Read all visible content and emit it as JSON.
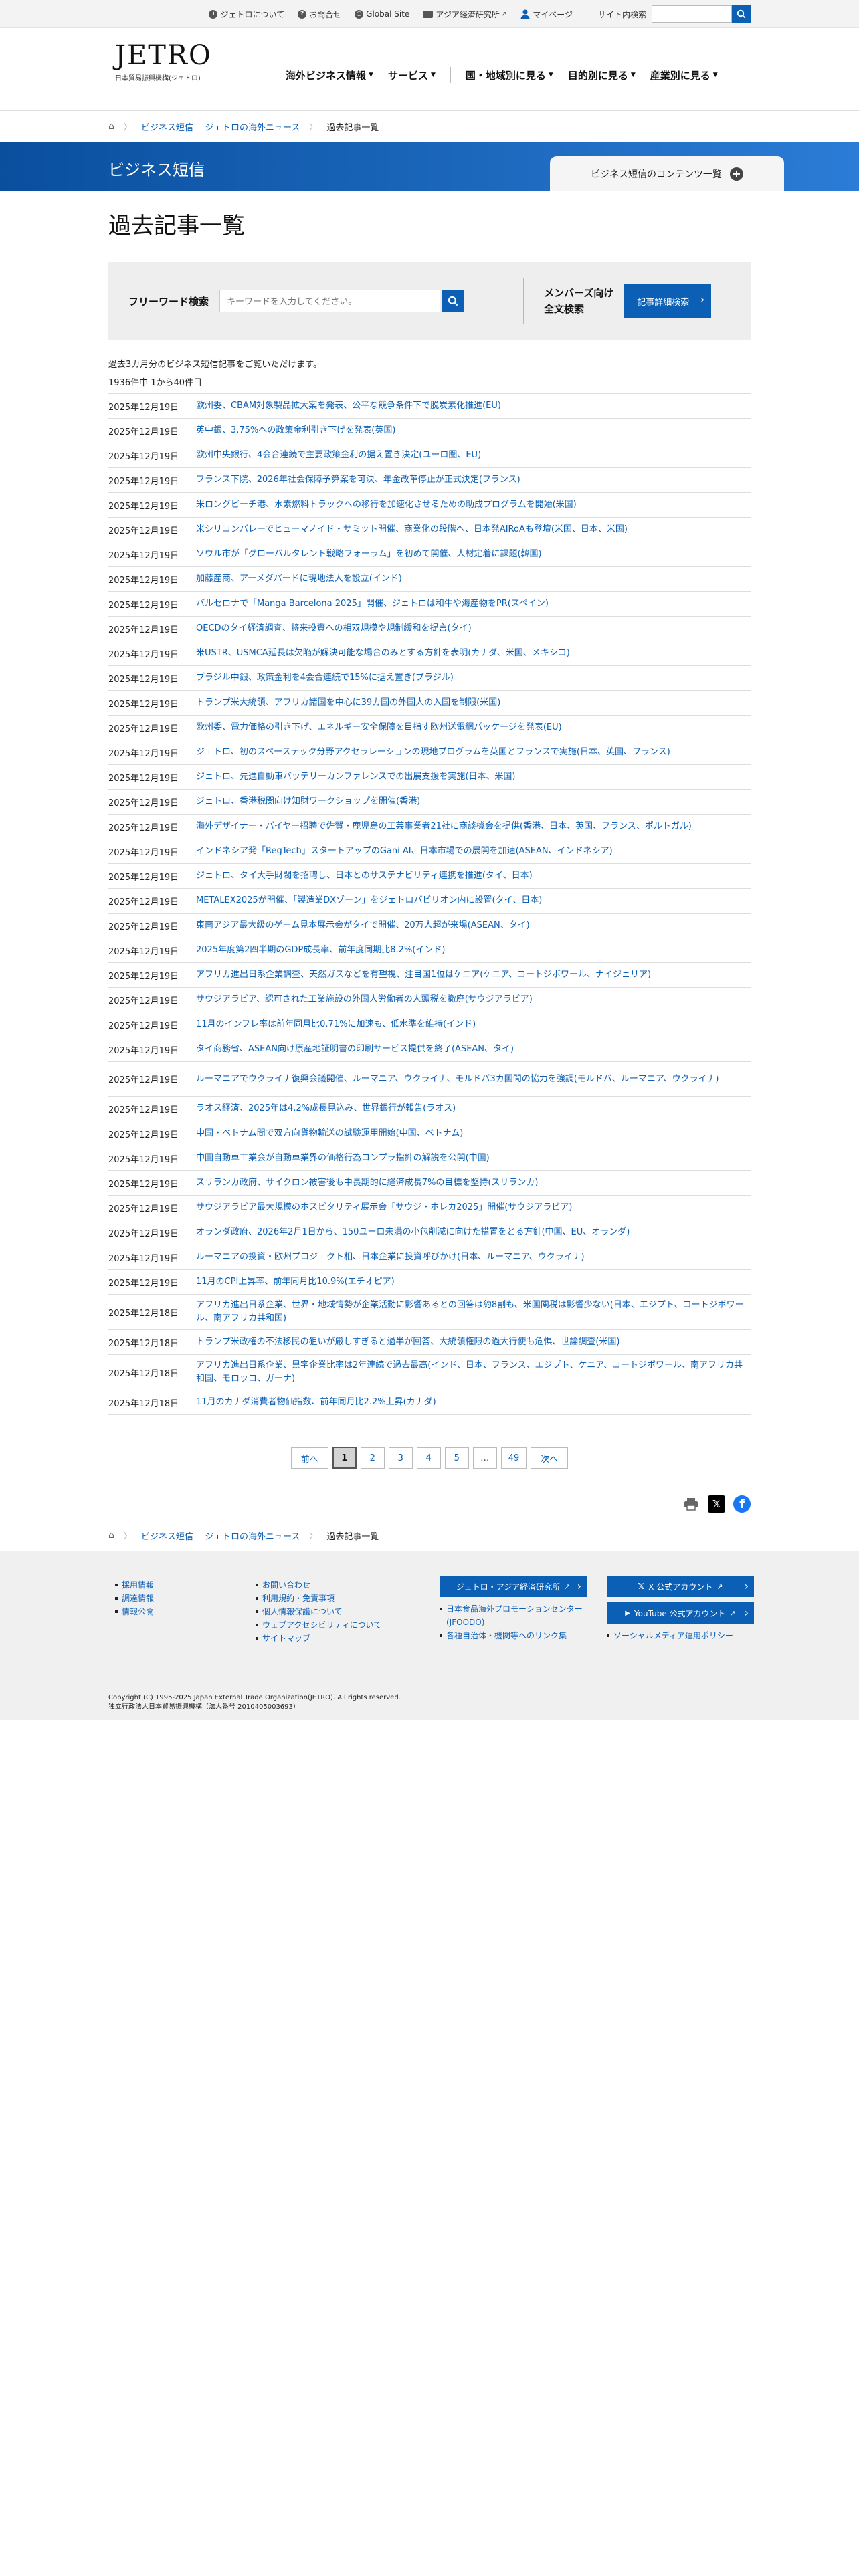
{
  "utility": {
    "about": "ジェトロについて",
    "contact": "お問合せ",
    "global": "Global Site",
    "ide": "アジア経済研究所",
    "mypage": "マイページ",
    "site_search_label": "サイト内検索"
  },
  "logo": {
    "main": "JETRO",
    "sub": "日本貿易振興機構(ジェトロ)"
  },
  "gnav": [
    {
      "label": "海外ビジネス情報"
    },
    {
      "label": "サービス"
    },
    {
      "label": "国・地域別に見る"
    },
    {
      "label": "目的別に見る"
    },
    {
      "label": "産業別に見る"
    }
  ],
  "breadcrumb": {
    "level1": "ビジネス短信 —ジェトロの海外ニュース",
    "current": "過去記事一覧"
  },
  "banner": {
    "title": "ビジネス短信",
    "contents_button": "ビジネス短信のコンテンツ一覧"
  },
  "page_title": "過去記事一覧",
  "search": {
    "freeword_label": "フリーワード検索",
    "placeholder": "キーワードを入力してください。",
    "members_label_1": "メンバーズ向け",
    "members_label_2": "全文検索",
    "detail_button": "記事詳細検索"
  },
  "intro": "過去3カ月分のビジネス短信記事をご覧いただけます。",
  "count": "1936件中 1から40件目",
  "news": [
    {
      "date": "2025年12月19日",
      "title": "欧州委、CBAM対象製品拡大案を発表、公平な競争条件下で脱炭素化推進(EU)"
    },
    {
      "date": "2025年12月19日",
      "title": "英中銀、3.75%への政策金利引き下げを発表(英国)"
    },
    {
      "date": "2025年12月19日",
      "title": "欧州中央銀行、4会合連続で主要政策金利の据え置き決定(ユーロ圏、EU)"
    },
    {
      "date": "2025年12月19日",
      "title": "フランス下院、2026年社会保障予算案を可決、年金改革停止が正式決定(フランス)"
    },
    {
      "date": "2025年12月19日",
      "title": "米ロングビーチ港、水素燃料トラックへの移行を加速化させるための助成プログラムを開始(米国)"
    },
    {
      "date": "2025年12月19日",
      "title": "米シリコンバレーでヒューマノイド・サミット開催、商業化の段階へ、日本発AIRoAも登壇(米国、日本、米国)"
    },
    {
      "date": "2025年12月19日",
      "title": "ソウル市が「グローバルタレント戦略フォーラム」を初めて開催、人材定着に課題(韓国)"
    },
    {
      "date": "2025年12月19日",
      "title": "加藤産商、アーメダバードに現地法人を設立(インド)"
    },
    {
      "date": "2025年12月19日",
      "title": "バルセロナで「Manga Barcelona 2025」開催、ジェトロは和牛や海産物をPR(スペイン)"
    },
    {
      "date": "2025年12月19日",
      "title": "OECDのタイ経済調査、将来投資への相双規模や規制緩和を提言(タイ)"
    },
    {
      "date": "2025年12月19日",
      "title": "米USTR、USMCA延長は欠陥が解決可能な場合のみとする方針を表明(カナダ、米国、メキシコ)"
    },
    {
      "date": "2025年12月19日",
      "title": "ブラジル中銀、政策金利を4会合連続で15%に据え置き(ブラジル)"
    },
    {
      "date": "2025年12月19日",
      "title": "トランプ米大統領、アフリカ諸国を中心に39カ国の外国人の入国を制限(米国)"
    },
    {
      "date": "2025年12月19日",
      "title": "欧州委、電力価格の引き下げ、エネルギー安全保障を目指す欧州送電網パッケージを発表(EU)"
    },
    {
      "date": "2025年12月19日",
      "title": "ジェトロ、初のスペーステック分野アクセラレーションの現地プログラムを英国とフランスで実施(日本、英国、フランス)"
    },
    {
      "date": "2025年12月19日",
      "title": "ジェトロ、先進自動車バッテリーカンファレンスでの出展支援を実施(日本、米国)"
    },
    {
      "date": "2025年12月19日",
      "title": "ジェトロ、香港税関向け知財ワークショップを開催(香港)"
    },
    {
      "date": "2025年12月19日",
      "title": "海外デザイナー・バイヤー招聘で佐賀・鹿児島の工芸事業者21社に商談機会を提供(香港、日本、英国、フランス、ポルトガル)"
    },
    {
      "date": "2025年12月19日",
      "title": "インドネシア発「RegTech」スタートアップのGani AI、日本市場での展開を加速(ASEAN、インドネシア)"
    },
    {
      "date": "2025年12月19日",
      "title": "ジェトロ、タイ大手財閥を招聘し、日本とのサステナビリティ連携を推進(タイ、日本)"
    },
    {
      "date": "2025年12月19日",
      "title": "METALEX2025が開催、「製造業DXゾーン」をジェトロパビリオン内に設置(タイ、日本)"
    },
    {
      "date": "2025年12月19日",
      "title": "東南アジア最大級のゲーム見本展示会がタイで開催、20万人超が来場(ASEAN、タイ)"
    },
    {
      "date": "2025年12月19日",
      "title": "2025年度第2四半期のGDP成長率、前年度同期比8.2%(インド)"
    },
    {
      "date": "2025年12月19日",
      "title": "アフリカ進出日系企業調査、天然ガスなどを有望視、注目国1位はケニア(ケニア、コートジボワール、ナイジェリア)"
    },
    {
      "date": "2025年12月19日",
      "title": "サウジアラビア、認可された工業施設の外国人労働者の人頭税を撤廃(サウジアラビア)"
    },
    {
      "date": "2025年12月19日",
      "title": "11月のインフレ率は前年同月比0.71%に加速も、低水準を維持(インド)"
    },
    {
      "date": "2025年12月19日",
      "title": "タイ商務省、ASEAN向け原産地証明書の印刷サービス提供を終了(ASEAN、タイ)"
    },
    {
      "date": "2025年12月19日",
      "title": "ルーマニアでウクライナ復興会議開催、ルーマニア、ウクライナ、モルドバ3カ国間の協力を強調(モルドバ、ルーマニア、ウクライナ)"
    },
    {
      "date": "2025年12月19日",
      "title": "ラオス経済、2025年は4.2%成長見込み、世界銀行が報告(ラオス)"
    },
    {
      "date": "2025年12月19日",
      "title": "中国・ベトナム間で双方向貨物輸送の試験運用開始(中国、ベトナム)"
    },
    {
      "date": "2025年12月19日",
      "title": "中国自動車工業会が自動車業界の価格行為コンプラ指針の解説を公開(中国)"
    },
    {
      "date": "2025年12月19日",
      "title": "スリランカ政府、サイクロン被害後も中長期的に経済成長7%の目標を堅持(スリランカ)"
    },
    {
      "date": "2025年12月19日",
      "title": "サウジアラビア最大規模のホスピタリティ展示会「サウジ・ホレカ2025」開催(サウジアラビア)"
    },
    {
      "date": "2025年12月19日",
      "title": "オランダ政府、2026年2月1日から、150ユーロ未満の小包削減に向けた措置をとる方針(中国、EU、オランダ)"
    },
    {
      "date": "2025年12月19日",
      "title": "ルーマニアの投資・欧州プロジェクト相、日本企業に投資呼びかけ(日本、ルーマニア、ウクライナ)"
    },
    {
      "date": "2025年12月19日",
      "title": "11月のCPI上昇率、前年同月比10.9%(エチオピア)"
    },
    {
      "date": "2025年12月18日",
      "title": "アフリカ進出日系企業、世界・地域情勢が企業活動に影響あるとの回答は約8割も、米国関税は影響少ない(日本、エジプト、コートジボワール、南アフリカ共和国)"
    },
    {
      "date": "2025年12月18日",
      "title": "トランプ米政権の不法移民の狙いが厳しすぎると過半が回答、大統領権限の過大行使も危惧、世論調査(米国)"
    },
    {
      "date": "2025年12月18日",
      "title": "アフリカ進出日系企業、黒字企業比率は2年連続で過去最高(インド、日本、フランス、エジプト、ケニア、コートジボワール、南アフリカ共和国、モロッコ、ガーナ)"
    },
    {
      "date": "2025年12月18日",
      "title": "11月のカナダ消費者物価指数、前年同月比2.2%上昇(カナダ)"
    }
  ],
  "pagination": {
    "prev": "前へ",
    "pages": [
      "1",
      "2",
      "3",
      "4",
      "5"
    ],
    "dots": "…",
    "last": "49",
    "next": "次へ",
    "current_page": 1
  },
  "footer": {
    "col1": [
      "採用情報",
      "調達情報",
      "情報公開"
    ],
    "col2": [
      "お問い合わせ",
      "利用規約・免責事項",
      "個人情報保護について",
      "ウェブアクセシビリティについて",
      "サイトマップ"
    ],
    "col3_button": "ジェトロ・アジア経済研究所",
    "col3_links": [
      "日本食品海外プロモーションセンター(JFOODO)",
      "各種自治体・機関等へのリンク集"
    ],
    "col4_x_button": "X 公式アカウント",
    "col4_yt_button": "YouTube 公式アカウント",
    "col4_links": [
      "ソーシャルメディア運用ポリシー"
    ],
    "copyright_1": "Copyright (C) 1995-2025 Japan External Trade Organization(JETRO). All rights reserved.",
    "copyright_2": "独立行政法人日本貿易振興機構（法人番号 2010405003693）"
  },
  "colors": {
    "brand_blue": "#0b5fb5",
    "banner_start": "#0a4f9e",
    "banner_end": "#2b7cd6"
  }
}
